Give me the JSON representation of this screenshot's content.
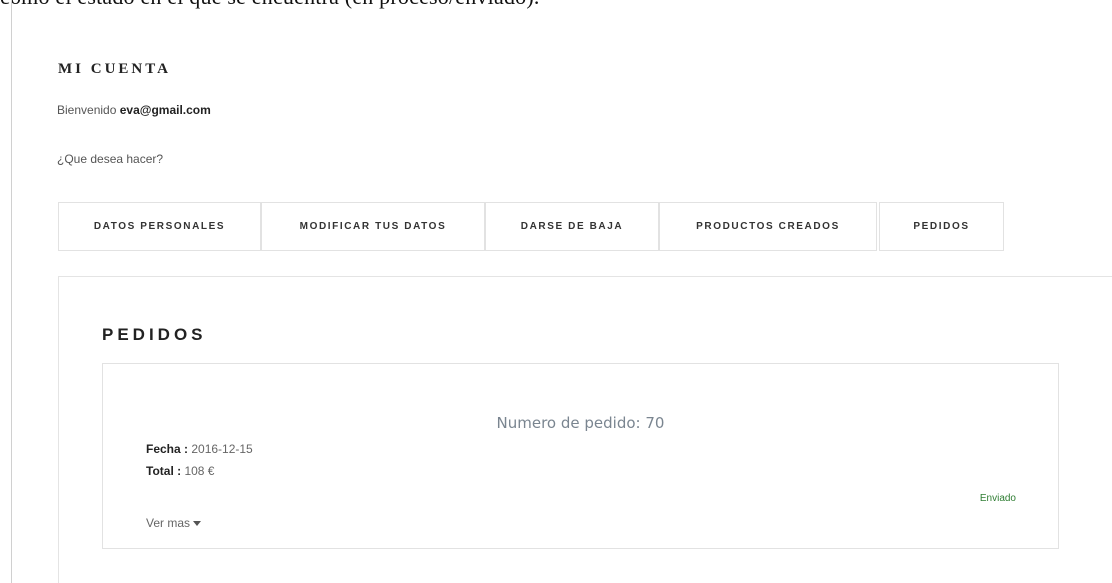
{
  "header": {
    "cut_text": "como el estado en el que se encuentra (en proceso/enviado)."
  },
  "account": {
    "title": "MI CUENTA",
    "welcome_prefix": "Bienvenido ",
    "user_email": "eva@gmail.com",
    "question": "¿Que desea hacer?"
  },
  "tabs": [
    {
      "label": "DATOS PERSONALES"
    },
    {
      "label": "MODIFICAR TUS DATOS"
    },
    {
      "label": "DARSE DE BAJA"
    },
    {
      "label": "PRODUCTOS CREADOS"
    },
    {
      "label": "PEDIDOS"
    }
  ],
  "orders_panel": {
    "title": "PEDIDOS",
    "order": {
      "number_label": "Numero de pedido: 70",
      "date_label": "Fecha :",
      "date_value": " 2016-12-15",
      "total_label": "Total :",
      "total_value": " 108 €",
      "status": "Enviado",
      "more_label": "Ver mas",
      "status_color": "#2e7d32"
    }
  },
  "icons": {
    "more_caret": "caret-down-icon"
  }
}
